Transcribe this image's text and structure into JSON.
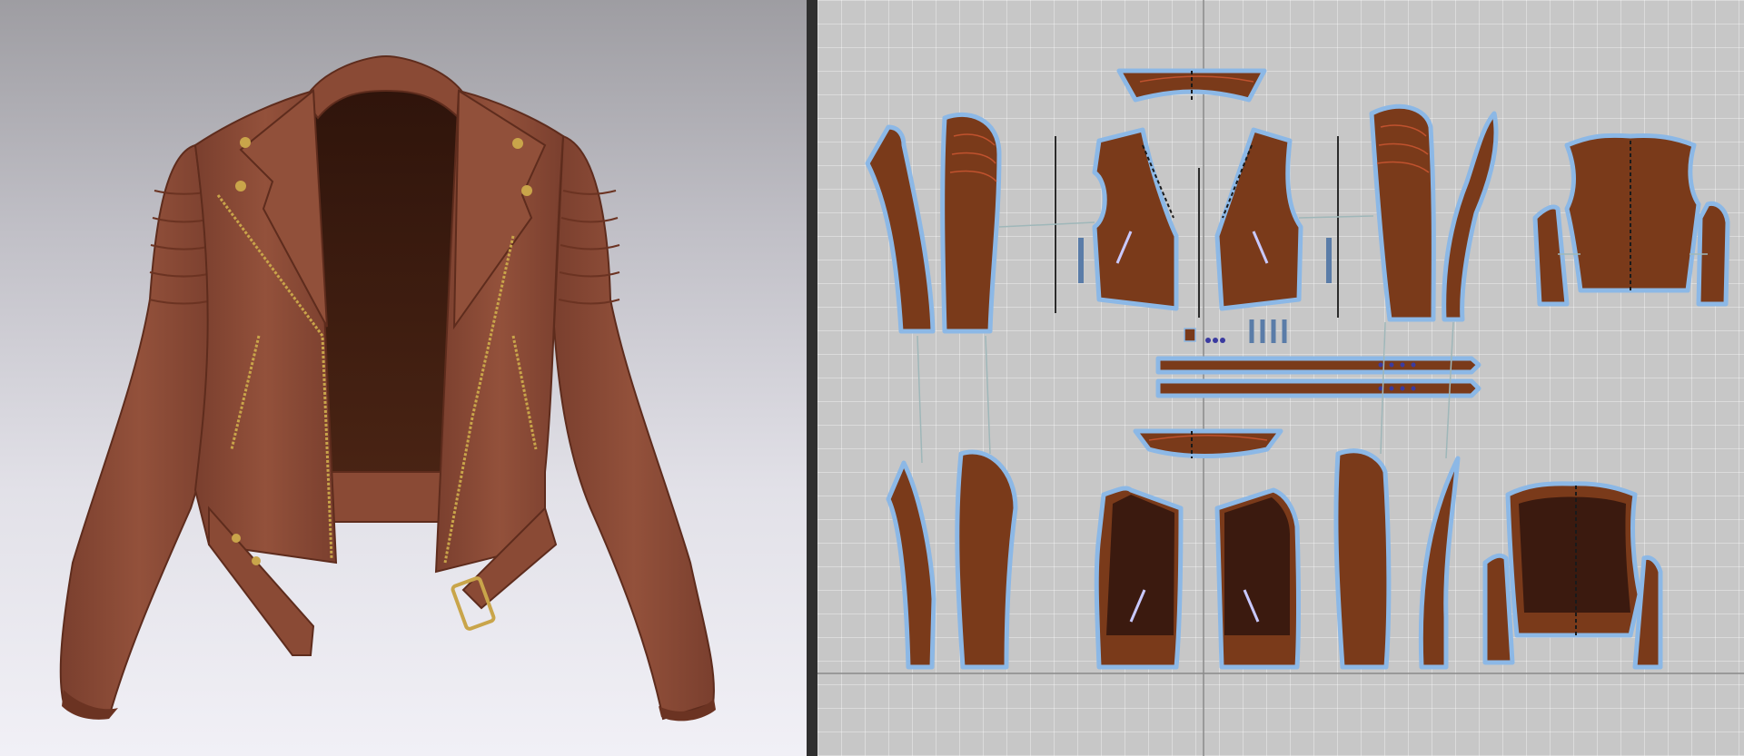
{
  "app": {
    "layout": "split-view",
    "views": [
      "3d-avatar-view",
      "2d-pattern-view"
    ]
  },
  "garment": {
    "type": "leather biker jacket",
    "material": "leather"
  },
  "colors": {
    "leather": "#8a4a35",
    "leather_dark": "#5e2c1d",
    "lining": "#3b1a0f",
    "hardware": "#c9a54a",
    "pattern_fill": "#7a3a1a",
    "pattern_outline": "#8cb8e6",
    "grid_bg": "#c7c7c7"
  }
}
